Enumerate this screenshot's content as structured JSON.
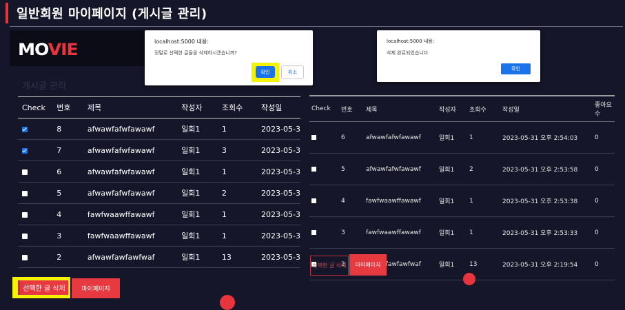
{
  "page": {
    "title": "일반회원 마이페이지 (게시글 관리)"
  },
  "logo": {
    "part1": "MO",
    "part2": "VIE"
  },
  "left_panel": {
    "list_heading": "게시글 관리",
    "columns": [
      "Check",
      "번호",
      "제목",
      "작성자",
      "조회수",
      "작성일"
    ],
    "rows": [
      {
        "checked": true,
        "num": "8",
        "title": "afwawfafwfawawf",
        "author": "일회1",
        "views": "1",
        "date": "2023-05-3"
      },
      {
        "checked": true,
        "num": "7",
        "title": "afwawfafwfawawf",
        "author": "일회1",
        "views": "3",
        "date": "2023-05-3"
      },
      {
        "checked": false,
        "num": "6",
        "title": "afwawfafwfawawf",
        "author": "일회1",
        "views": "1",
        "date": "2023-05-3"
      },
      {
        "checked": false,
        "num": "5",
        "title": "afwawfafwfawawf",
        "author": "일회1",
        "views": "2",
        "date": "2023-05-3"
      },
      {
        "checked": false,
        "num": "4",
        "title": "fawfwaawffawawf",
        "author": "일회1",
        "views": "1",
        "date": "2023-05-3"
      },
      {
        "checked": false,
        "num": "3",
        "title": "fawfwaawffawawf",
        "author": "일회1",
        "views": "1",
        "date": "2023-05-3"
      },
      {
        "checked": false,
        "num": "2",
        "title": "afwawfawfawfwaf",
        "author": "일회1",
        "views": "13",
        "date": "2023-05-3"
      }
    ],
    "delete_button": "선택한 글 삭제",
    "mypage_button": "마이페이지"
  },
  "right_panel": {
    "columns": [
      "Check",
      "번호",
      "제목",
      "작성자",
      "조회수",
      "작성일",
      "좋아요 수"
    ],
    "rows": [
      {
        "num": "6",
        "title": "afwawfafwfawawf",
        "author": "일회1",
        "views": "1",
        "date": "2023-05-31 오후 2:54:03",
        "likes": "0"
      },
      {
        "num": "5",
        "title": "afwawfafwfawawf",
        "author": "일회1",
        "views": "2",
        "date": "2023-05-31 오후 2:53:58",
        "likes": "0"
      },
      {
        "num": "4",
        "title": "fawfwaawffawawf",
        "author": "일회1",
        "views": "1",
        "date": "2023-05-31 오후 2:53:38",
        "likes": "0"
      },
      {
        "num": "3",
        "title": "fawfwaawffawawf",
        "author": "일회1",
        "views": "1",
        "date": "2023-05-31 오후 2:53:33",
        "likes": "0"
      },
      {
        "num": "2",
        "title": "afwawfawfawfwaf",
        "author": "일회1",
        "views": "13",
        "date": "2023-05-31 오후 2:19:54",
        "likes": "0"
      }
    ],
    "delete_button": "선택한 글 삭제",
    "mypage_button": "마이페이지"
  },
  "confirm_dialog": {
    "origin": "localhost:5000 내용:",
    "message": "정말로 선택한 글들을 삭제하시겠습니까?",
    "ok": "확인",
    "cancel": "취소"
  },
  "alert_dialog": {
    "origin": "localhost:5000 내용:",
    "message": "삭제 완료되었습니다",
    "ok": "확인"
  },
  "colors": {
    "accent": "#e8343c",
    "background": "#16162a",
    "highlight": "#f4f400",
    "dialog_button": "#1a73e8"
  }
}
